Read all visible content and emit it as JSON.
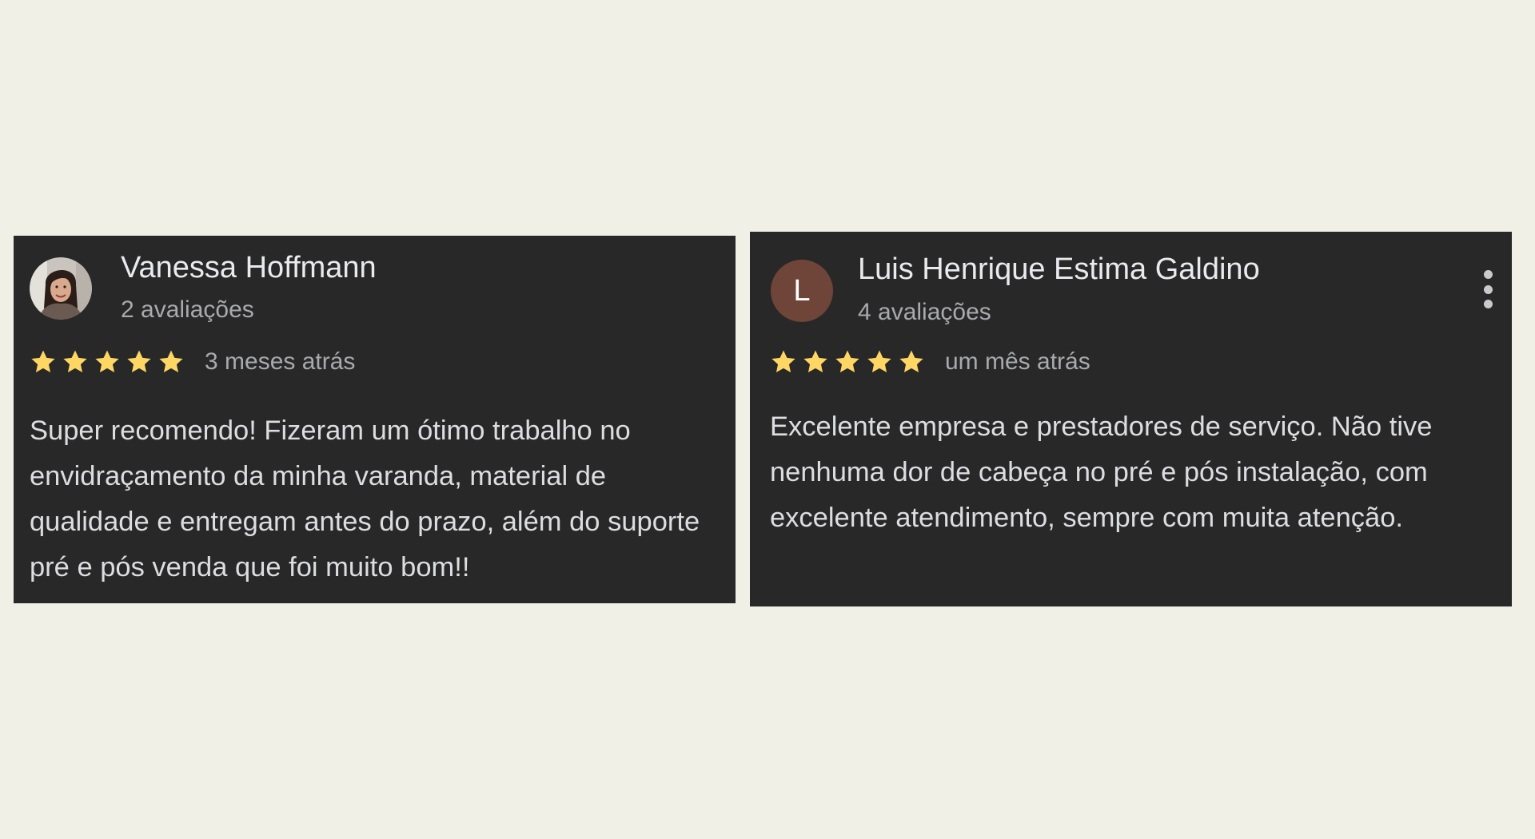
{
  "colors": {
    "page_background": "#f0f0e6",
    "card_background": "#282829",
    "star": "#fdd663",
    "avatar_l_background": "#6e4538"
  },
  "reviews": [
    {
      "author": "Vanessa Hoffmann",
      "review_count": "2 avaliações",
      "rating": 5,
      "time": "3 meses atrás",
      "text": "Super recomendo! Fizeram um ótimo trabalho no envidraçamento da minha varanda, material de qualidade e entregam antes do prazo, além do suporte pré e pós venda que foi muito bom!!",
      "avatar": "profile-photo"
    },
    {
      "author": "Luis Henrique Estima Galdino",
      "review_count": "4 avaliações",
      "rating": 5,
      "time": "um mês atrás",
      "text": "Excelente empresa e prestadores de serviço. Não tive nenhuma dor de cabeça no pré e pós instalação, com excelente atendimento, sempre com muita atenção.",
      "avatar_letter": "L",
      "menu_icon": "more-vert-icon"
    }
  ]
}
